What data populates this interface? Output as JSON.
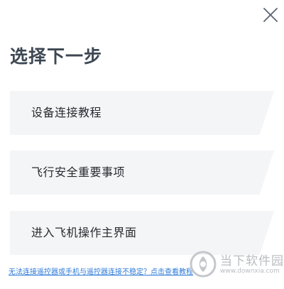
{
  "dialog": {
    "title": "选择下一步",
    "close_icon": "close-icon"
  },
  "options": [
    {
      "label": "设备连接教程"
    },
    {
      "label": "飞行安全重要事项"
    },
    {
      "label": "进入飞机操作主界面"
    }
  ],
  "help_link": {
    "text": "无法连接遥控器或手机与遥控器连接不稳定？点击查看教程"
  },
  "watermark": {
    "name": "当下软件园",
    "url": "www.downxia.com",
    "icon": "downxia-logo-icon"
  },
  "colors": {
    "title": "#3d4753",
    "option_bg": "#f4f5f7",
    "option_text": "#26292e",
    "link": "#2d7ad9",
    "watermark": "#b9bcc1"
  }
}
